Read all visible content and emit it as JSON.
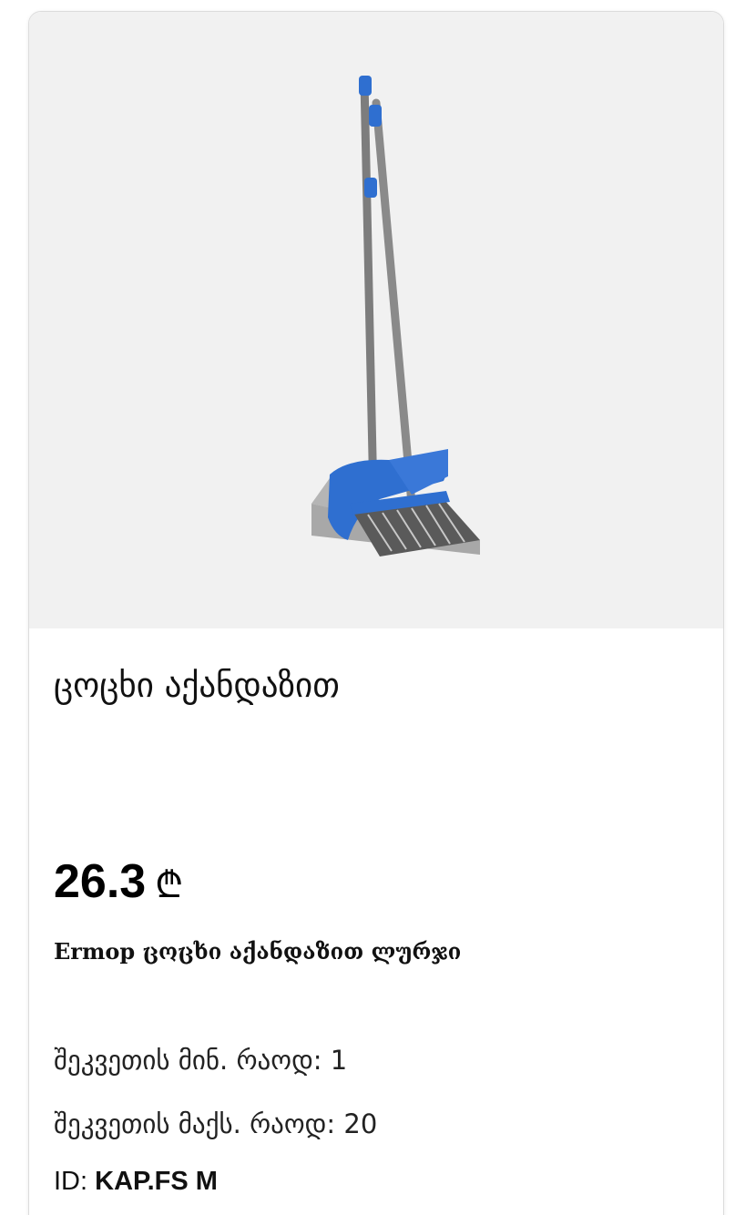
{
  "product": {
    "image_alt": "ცოცხი აქანდაზით",
    "title": "ცოცხი აქანდაზით",
    "price": {
      "value": "26.3",
      "currency": "₾"
    },
    "description": "Ermop ცოცხი აქანდაზით ლურჯი",
    "order_min": {
      "label": "შეკვეთის მინ. რაოდ:",
      "value": "1"
    },
    "order_max": {
      "label": "შეკვეთის მაქს. რაოდ:",
      "value": "20"
    },
    "id": {
      "label": "ID:",
      "value": "KAP.FS M"
    }
  },
  "colors": {
    "accent_blue": "#2f6fd0",
    "image_bg": "#f1f1f1",
    "card_border": "#dcdcdc"
  }
}
